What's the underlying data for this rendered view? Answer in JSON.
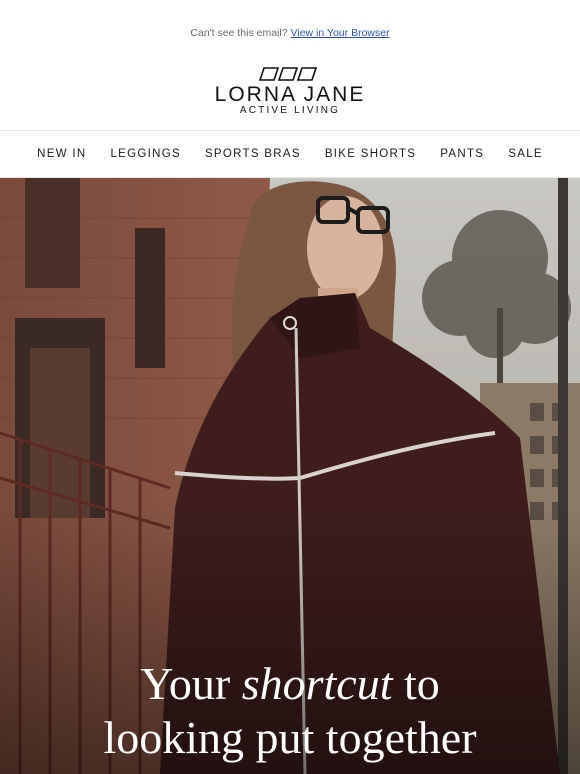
{
  "preheader": {
    "text": "Can't see this email?",
    "link": "View in Your Browser"
  },
  "logo": {
    "icon": "lorna-jane-parallelograms-icon",
    "brand": "LORNA JANE",
    "tagline": "ACTIVE LIVING"
  },
  "nav": {
    "items": [
      "NEW IN",
      "LEGGINGS",
      "SPORTS BRAS",
      "BIKE SHORTS",
      "PANTS",
      "SALE"
    ]
  },
  "hero": {
    "image": "woman-in-maroon-jacket-street-photo",
    "headline_line1_prefix": "Your",
    "headline_line1_emphasis": "shortcut",
    "headline_line1_suffix": "to",
    "headline_line2": "looking put together"
  }
}
